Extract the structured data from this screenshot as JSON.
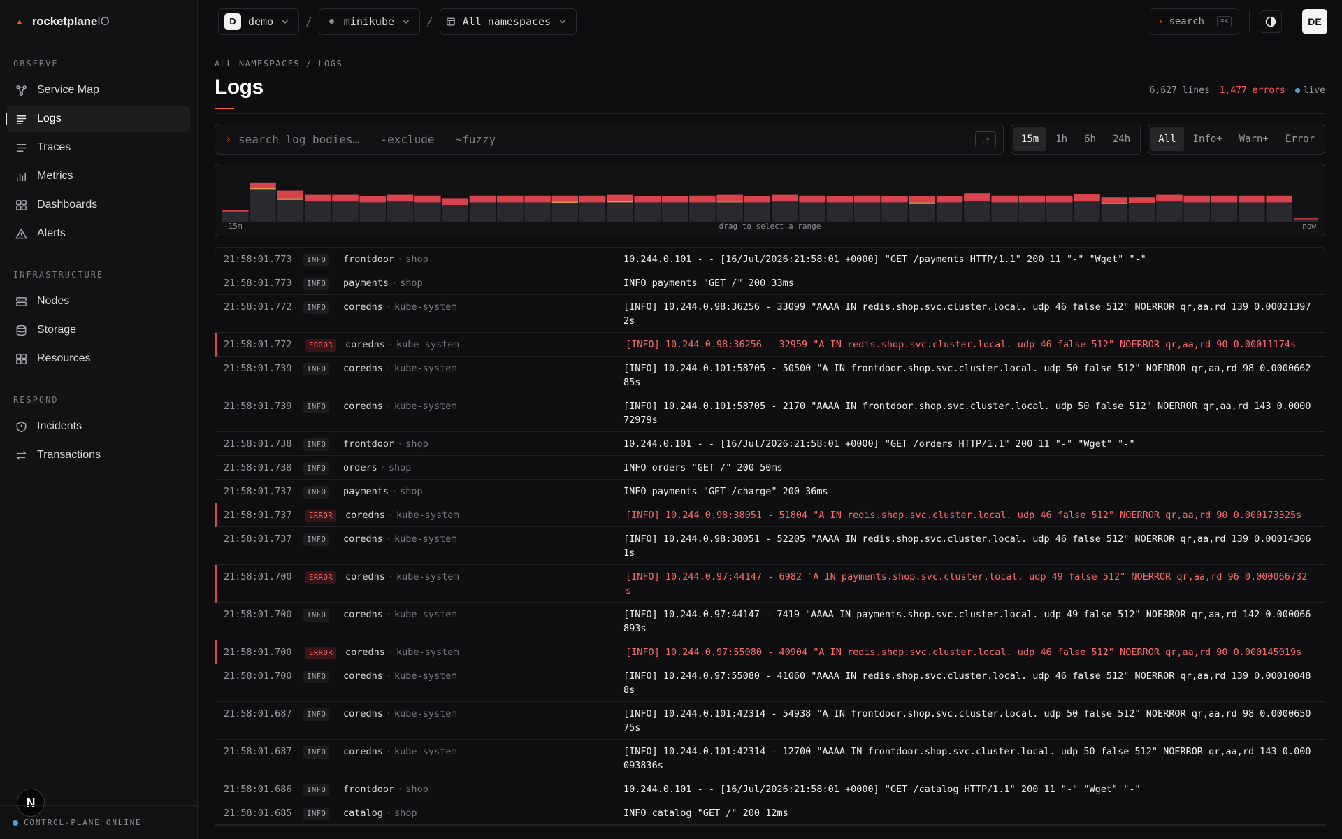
{
  "brand": {
    "name": "rocketplane",
    "suffix": "IO"
  },
  "sidebar": {
    "sections": [
      {
        "title": "OBSERVE",
        "items": [
          {
            "label": "Service Map",
            "icon": "service-map-icon"
          },
          {
            "label": "Logs",
            "icon": "logs-icon",
            "active": true
          },
          {
            "label": "Traces",
            "icon": "traces-icon"
          },
          {
            "label": "Metrics",
            "icon": "metrics-icon"
          },
          {
            "label": "Dashboards",
            "icon": "dashboards-icon"
          },
          {
            "label": "Alerts",
            "icon": "alerts-icon"
          }
        ]
      },
      {
        "title": "INFRASTRUCTURE",
        "items": [
          {
            "label": "Nodes",
            "icon": "nodes-icon"
          },
          {
            "label": "Storage",
            "icon": "storage-icon"
          },
          {
            "label": "Resources",
            "icon": "resources-icon"
          }
        ]
      },
      {
        "title": "RESPOND",
        "items": [
          {
            "label": "Incidents",
            "icon": "incidents-icon"
          },
          {
            "label": "Transactions",
            "icon": "transactions-icon"
          }
        ]
      }
    ],
    "footer_status": "CONTROL-PLANE ONLINE",
    "n_badge": "N"
  },
  "topbar": {
    "org": {
      "initial": "D",
      "label": "demo"
    },
    "cluster": {
      "label": "minikube"
    },
    "namespace": {
      "label": "All namespaces"
    },
    "search": {
      "label": "search",
      "shortcut": "⌘K"
    },
    "user_initials": "DE"
  },
  "page": {
    "breadcrumb": "ALL NAMESPACES / LOGS",
    "title": "Logs",
    "stats": {
      "lines": "6,627 lines",
      "errors": "1,477 errors",
      "live": "live"
    }
  },
  "filters": {
    "query_placeholder": "search log bodies…",
    "hint_exclude": "-exclude",
    "hint_fuzzy": "~fuzzy",
    "regex_label": ".*",
    "ranges": [
      {
        "label": "15m",
        "active": true
      },
      {
        "label": "1h"
      },
      {
        "label": "6h"
      },
      {
        "label": "24h"
      }
    ],
    "levels": [
      {
        "label": "All",
        "active": true
      },
      {
        "label": "Info+"
      },
      {
        "label": "Warn+"
      },
      {
        "label": "Error"
      }
    ]
  },
  "histogram": {
    "start_label": "-15m",
    "mid_label": "drag to select a range",
    "end_label": "now",
    "colors": {
      "info": "#2a2a2e",
      "warn": "#d9a04a",
      "error": "#d9434d"
    },
    "buckets": [
      {
        "info": 12,
        "warn": 0,
        "error": 2
      },
      {
        "info": 38,
        "warn": 2,
        "error": 6
      },
      {
        "info": 26,
        "warn": 2,
        "error": 9
      },
      {
        "info": 24,
        "warn": 0,
        "error": 8
      },
      {
        "info": 24,
        "warn": 0,
        "error": 8
      },
      {
        "info": 23,
        "warn": 0,
        "error": 7
      },
      {
        "info": 24,
        "warn": 0,
        "error": 8
      },
      {
        "info": 23,
        "warn": 0,
        "error": 8
      },
      {
        "info": 20,
        "warn": 0,
        "error": 8
      },
      {
        "info": 23,
        "warn": 0,
        "error": 8
      },
      {
        "info": 23,
        "warn": 0,
        "error": 8
      },
      {
        "info": 23,
        "warn": 0,
        "error": 8
      },
      {
        "info": 22,
        "warn": 2,
        "error": 7
      },
      {
        "info": 23,
        "warn": 0,
        "error": 8
      },
      {
        "info": 23,
        "warn": 2,
        "error": 7
      },
      {
        "info": 23,
        "warn": 0,
        "error": 7
      },
      {
        "info": 23,
        "warn": 0,
        "error": 7
      },
      {
        "info": 23,
        "warn": 0,
        "error": 8
      },
      {
        "info": 23,
        "warn": 1,
        "error": 8
      },
      {
        "info": 23,
        "warn": 0,
        "error": 7
      },
      {
        "info": 24,
        "warn": 0,
        "error": 8
      },
      {
        "info": 23,
        "warn": 0,
        "error": 8
      },
      {
        "info": 23,
        "warn": 0,
        "error": 7
      },
      {
        "info": 23,
        "warn": 0,
        "error": 8
      },
      {
        "info": 23,
        "warn": 0,
        "error": 7
      },
      {
        "info": 21,
        "warn": 2,
        "error": 7
      },
      {
        "info": 23,
        "warn": 0,
        "error": 7
      },
      {
        "info": 25,
        "warn": 0,
        "error": 9
      },
      {
        "info": 23,
        "warn": 0,
        "error": 8
      },
      {
        "info": 23,
        "warn": 0,
        "error": 8
      },
      {
        "info": 23,
        "warn": 0,
        "error": 8
      },
      {
        "info": 24,
        "warn": 0,
        "error": 9
      },
      {
        "info": 21,
        "warn": 1,
        "error": 7
      },
      {
        "info": 22,
        "warn": 0,
        "error": 7
      },
      {
        "info": 24,
        "warn": 0,
        "error": 8
      },
      {
        "info": 23,
        "warn": 0,
        "error": 8
      },
      {
        "info": 23,
        "warn": 0,
        "error": 8
      },
      {
        "info": 23,
        "warn": 0,
        "error": 8
      },
      {
        "info": 23,
        "warn": 0,
        "error": 8
      },
      {
        "info": 3,
        "warn": 0,
        "error": 1
      }
    ]
  },
  "logs": [
    {
      "ts": "21:58:01.773",
      "level": "INFO",
      "service": "frontdoor",
      "ns": "shop",
      "msg": "10.244.0.101 - - [16/Jul/2026:21:58:01 +0000] \"GET /payments HTTP/1.1\" 200 11 \"-\" \"Wget\" \"-\""
    },
    {
      "ts": "21:58:01.773",
      "level": "INFO",
      "service": "payments",
      "ns": "shop",
      "msg": "INFO payments \"GET /\" 200 33ms"
    },
    {
      "ts": "21:58:01.772",
      "level": "INFO",
      "service": "coredns",
      "ns": "kube-system",
      "msg": "[INFO] 10.244.0.98:36256 - 33099 \"AAAA IN redis.shop.svc.cluster.local. udp 46 false 512\" NOERROR qr,aa,rd 139 0.000213972s"
    },
    {
      "ts": "21:58:01.772",
      "level": "ERROR",
      "service": "coredns",
      "ns": "kube-system",
      "msg": "[INFO] 10.244.0.98:36256 - 32959 \"A IN redis.shop.svc.cluster.local. udp 46 false 512\" NOERROR qr,aa,rd 90 0.00011174s"
    },
    {
      "ts": "21:58:01.739",
      "level": "INFO",
      "service": "coredns",
      "ns": "kube-system",
      "msg": "[INFO] 10.244.0.101:58705 - 50500 \"A IN frontdoor.shop.svc.cluster.local. udp 50 false 512\" NOERROR qr,aa,rd 98 0.000066285s"
    },
    {
      "ts": "21:58:01.739",
      "level": "INFO",
      "service": "coredns",
      "ns": "kube-system",
      "msg": "[INFO] 10.244.0.101:58705 - 2170 \"AAAA IN frontdoor.shop.svc.cluster.local. udp 50 false 512\" NOERROR qr,aa,rd 143 0.000072979s"
    },
    {
      "ts": "21:58:01.738",
      "level": "INFO",
      "service": "frontdoor",
      "ns": "shop",
      "msg": "10.244.0.101 - - [16/Jul/2026:21:58:01 +0000] \"GET /orders HTTP/1.1\" 200 11 \"-\" \"Wget\" \"-\""
    },
    {
      "ts": "21:58:01.738",
      "level": "INFO",
      "service": "orders",
      "ns": "shop",
      "msg": "INFO orders \"GET /\" 200 50ms"
    },
    {
      "ts": "21:58:01.737",
      "level": "INFO",
      "service": "payments",
      "ns": "shop",
      "msg": "INFO payments \"GET /charge\" 200 36ms"
    },
    {
      "ts": "21:58:01.737",
      "level": "ERROR",
      "service": "coredns",
      "ns": "kube-system",
      "msg": "[INFO] 10.244.0.98:38051 - 51804 \"A IN redis.shop.svc.cluster.local. udp 46 false 512\" NOERROR qr,aa,rd 90 0.000173325s"
    },
    {
      "ts": "21:58:01.737",
      "level": "INFO",
      "service": "coredns",
      "ns": "kube-system",
      "msg": "[INFO] 10.244.0.98:38051 - 52205 \"AAAA IN redis.shop.svc.cluster.local. udp 46 false 512\" NOERROR qr,aa,rd 139 0.000143061s"
    },
    {
      "ts": "21:58:01.700",
      "level": "ERROR",
      "service": "coredns",
      "ns": "kube-system",
      "msg": "[INFO] 10.244.0.97:44147 - 6982 \"A IN payments.shop.svc.cluster.local. udp 49 false 512\" NOERROR qr,aa,rd 96 0.000066732s"
    },
    {
      "ts": "21:58:01.700",
      "level": "INFO",
      "service": "coredns",
      "ns": "kube-system",
      "msg": "[INFO] 10.244.0.97:44147 - 7419 \"AAAA IN payments.shop.svc.cluster.local. udp 49 false 512\" NOERROR qr,aa,rd 142 0.000066893s"
    },
    {
      "ts": "21:58:01.700",
      "level": "ERROR",
      "service": "coredns",
      "ns": "kube-system",
      "msg": "[INFO] 10.244.0.97:55080 - 40904 \"A IN redis.shop.svc.cluster.local. udp 46 false 512\" NOERROR qr,aa,rd 90 0.000145019s"
    },
    {
      "ts": "21:58:01.700",
      "level": "INFO",
      "service": "coredns",
      "ns": "kube-system",
      "msg": "[INFO] 10.244.0.97:55080 - 41060 \"AAAA IN redis.shop.svc.cluster.local. udp 46 false 512\" NOERROR qr,aa,rd 139 0.000100488s"
    },
    {
      "ts": "21:58:01.687",
      "level": "INFO",
      "service": "coredns",
      "ns": "kube-system",
      "msg": "[INFO] 10.244.0.101:42314 - 54938 \"A IN frontdoor.shop.svc.cluster.local. udp 50 false 512\" NOERROR qr,aa,rd 98 0.000065075s"
    },
    {
      "ts": "21:58:01.687",
      "level": "INFO",
      "service": "coredns",
      "ns": "kube-system",
      "msg": "[INFO] 10.244.0.101:42314 - 12700 \"AAAA IN frontdoor.shop.svc.cluster.local. udp 50 false 512\" NOERROR qr,aa,rd 143 0.000093836s"
    },
    {
      "ts": "21:58:01.686",
      "level": "INFO",
      "service": "frontdoor",
      "ns": "shop",
      "msg": "10.244.0.101 - - [16/Jul/2026:21:58:01 +0000] \"GET /catalog HTTP/1.1\" 200 11 \"-\" \"Wget\" \"-\""
    },
    {
      "ts": "21:58:01.685",
      "level": "INFO",
      "service": "catalog",
      "ns": "shop",
      "msg": "INFO catalog \"GET /\" 200 12ms"
    }
  ]
}
